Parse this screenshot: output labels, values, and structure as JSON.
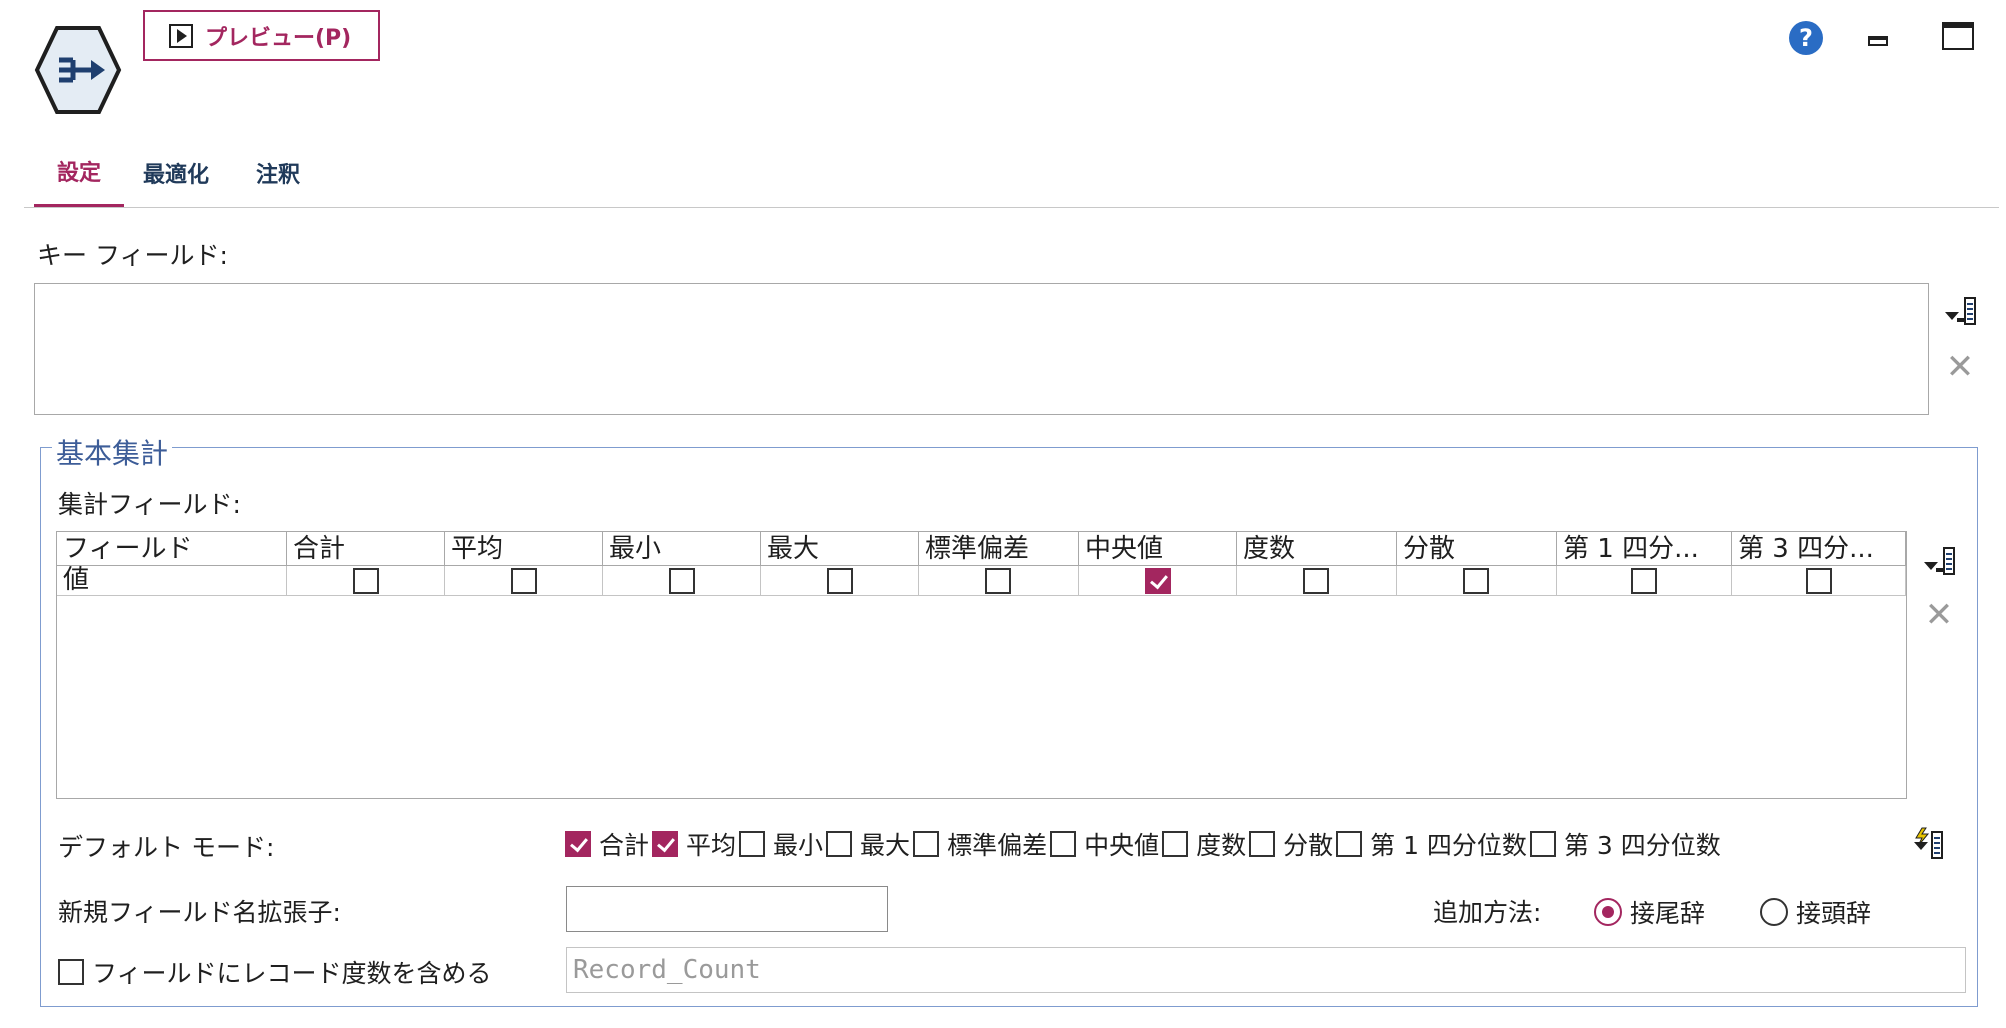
{
  "toolbar": {
    "preview_label": "プレビュー(P)",
    "help_glyph": "?"
  },
  "tabs": [
    {
      "label": "設定",
      "active": true
    },
    {
      "label": "最適化",
      "active": false
    },
    {
      "label": "注釈",
      "active": false
    }
  ],
  "key_fields": {
    "label": "キー フィールド:",
    "items": []
  },
  "basic_aggregation": {
    "legend": "基本集計",
    "agg_fields_label": "集計フィールド:",
    "columns": [
      "フィールド",
      "合計",
      "平均",
      "最小",
      "最大",
      "標準偏差",
      "中央値",
      "度数",
      "分散",
      "第 1 四分...",
      "第 3 四分..."
    ],
    "rows": [
      {
        "field": "値",
        "checks": [
          false,
          false,
          false,
          false,
          false,
          true,
          false,
          false,
          false,
          false
        ]
      }
    ],
    "default_mode_label": "デフォルト モード:",
    "default_modes": [
      {
        "label": "合計",
        "checked": true
      },
      {
        "label": "平均",
        "checked": true
      },
      {
        "label": "最小",
        "checked": false
      },
      {
        "label": "最大",
        "checked": false
      },
      {
        "label": "標準偏差",
        "checked": false
      },
      {
        "label": "中央値",
        "checked": false
      },
      {
        "label": "度数",
        "checked": false
      },
      {
        "label": "分散",
        "checked": false
      },
      {
        "label": "第 1 四分位数",
        "checked": false
      },
      {
        "label": "第 3 四分位数",
        "checked": false
      }
    ],
    "extension_label": "新規フィールド名拡張子:",
    "extension_value": "",
    "add_method_label": "追加方法:",
    "add_method_options": [
      {
        "label": "接尾辞",
        "selected": true
      },
      {
        "label": "接頭辞",
        "selected": false
      }
    ],
    "include_count_label": "フィールドにレコード度数を含める",
    "include_count_checked": false,
    "record_count_field": "Record_Count"
  },
  "colors": {
    "accent": "#a3265f",
    "legend": "#3d5d98",
    "help": "#2a6cc4"
  },
  "icons": [
    "aggregate-node-icon",
    "play-icon",
    "help-icon",
    "minimize-icon",
    "maximize-icon",
    "field-picker-icon",
    "delete-icon",
    "apply-defaults-icon"
  ]
}
